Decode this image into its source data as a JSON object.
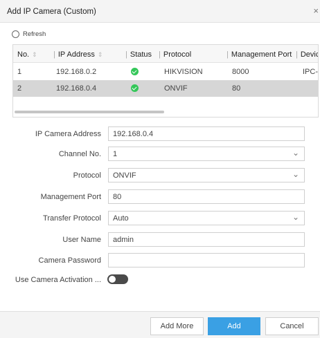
{
  "dialog": {
    "title": "Add IP Camera (Custom)",
    "close_glyph": "×"
  },
  "toolbar": {
    "refresh_label": "Refresh"
  },
  "table": {
    "columns": [
      "No.",
      "IP Address",
      "Status",
      "Protocol",
      "Management Port",
      "Devic"
    ],
    "rows": [
      {
        "no": "1",
        "ip": "192.168.0.2",
        "status": "online",
        "protocol": "HIKVISION",
        "port": "8000",
        "device": "IPC-I",
        "selected": false
      },
      {
        "no": "2",
        "ip": "192.168.0.4",
        "status": "online",
        "protocol": "ONVIF",
        "port": "80",
        "device": "",
        "selected": true
      }
    ],
    "status_color": "#34c759",
    "selected_row_color": "#d6d6d6"
  },
  "form": {
    "ip_label": "IP Camera Address",
    "ip_value": "192.168.0.4",
    "channel_label": "Channel No.",
    "channel_value": "1",
    "protocol_label": "Protocol",
    "protocol_value": "ONVIF",
    "port_label": "Management Port",
    "port_value": "80",
    "transfer_label": "Transfer Protocol",
    "transfer_value": "Auto",
    "user_label": "User Name",
    "user_value": "admin",
    "password_label": "Camera Password",
    "password_value": "",
    "activation_label": "Use Camera Activation ...",
    "activation_on": false
  },
  "footer": {
    "add_more_label": "Add More",
    "add_label": "Add",
    "cancel_label": "Cancel",
    "accent_color": "#3aa0e4"
  },
  "icons": {
    "refresh": "refresh-icon",
    "close": "close-icon",
    "sort": "sort-icon",
    "dropdown": "chevron-down-icon",
    "status": "check-circle-icon"
  }
}
